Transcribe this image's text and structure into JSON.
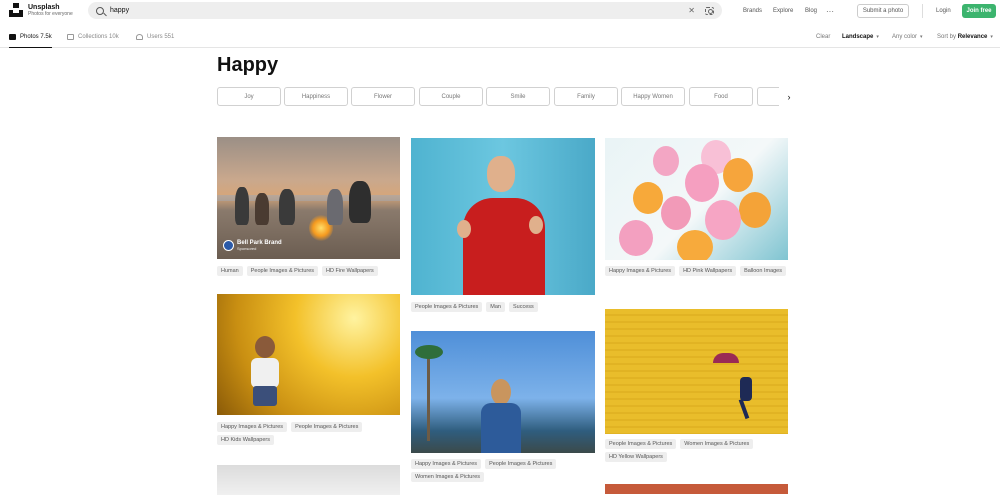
{
  "brand": {
    "name": "Unsplash",
    "tagline": "Photos for everyone"
  },
  "search": {
    "value": "happy",
    "clear_icon": "close-icon",
    "visual_icon": "visual-search-icon"
  },
  "nav": {
    "brands": "Brands",
    "explore": "Explore",
    "blog": "Blog",
    "more": "···",
    "submit": "Submit a photo",
    "login": "Login",
    "join": "Join free"
  },
  "subnav": {
    "tabs": [
      {
        "label": "Photos 7.5k",
        "icon": "photo-icon",
        "active": true
      },
      {
        "label": "Collections 10k",
        "icon": "collection-icon",
        "active": false
      },
      {
        "label": "Users 551",
        "icon": "user-icon",
        "active": false
      }
    ],
    "filters": {
      "clear": "Clear",
      "orientation": "Landscape",
      "color": "Any color",
      "sort_prefix": "Sort by",
      "sort_value": "Relevance"
    }
  },
  "page": {
    "title": "Happy"
  },
  "chips": [
    "Joy",
    "Happiness",
    "Flower",
    "Couple",
    "Smile",
    "Family",
    "Happy Women",
    "Food"
  ],
  "photos": [
    {
      "id": "p1",
      "badge": {
        "name": "Bell Park Brand",
        "sub": "Sponsored"
      },
      "tags": [
        "Human",
        "People Images & Pictures",
        "HD Fire Wallpapers"
      ]
    },
    {
      "id": "p2",
      "tags": [
        "People Images & Pictures",
        "Man",
        "Success"
      ]
    },
    {
      "id": "p3",
      "tags": [
        "Happy Images & Pictures",
        "HD Pink Wallpapers",
        "Balloon Images"
      ]
    },
    {
      "id": "p4",
      "tags": [
        "Happy Images & Pictures",
        "People Images & Pictures",
        "HD Kids Wallpapers"
      ]
    },
    {
      "id": "p5",
      "tags": [
        "Happy Images & Pictures",
        "People Images & Pictures",
        "Women Images & Pictures"
      ]
    },
    {
      "id": "p6",
      "tags": [
        "People Images & Pictures",
        "Women Images & Pictures",
        "HD Yellow Wallpapers"
      ]
    }
  ],
  "colors": {
    "accent_green": "#3cb46e",
    "text_primary": "#111111",
    "tag_bg": "#eeeeee"
  }
}
